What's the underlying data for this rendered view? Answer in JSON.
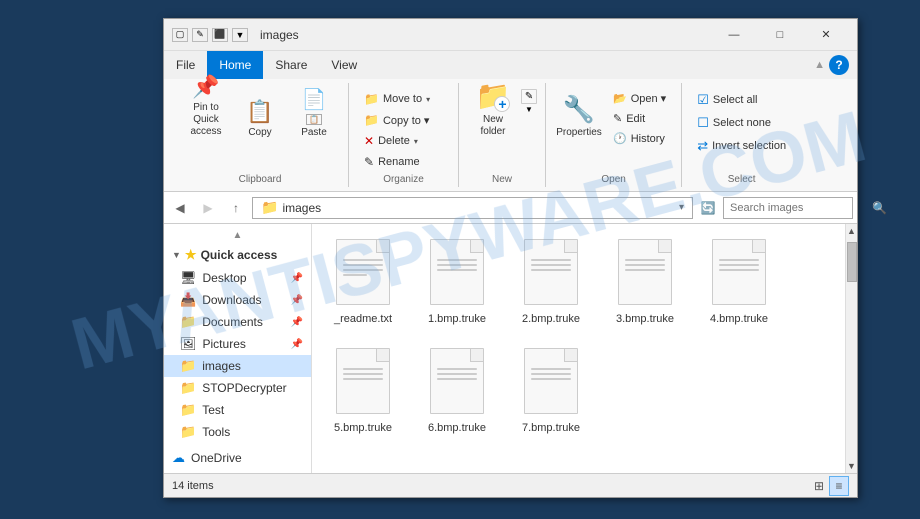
{
  "window": {
    "title": "images",
    "title_prefix": "▢ ✎ ⬛ ▼ ▪",
    "minimize": "—",
    "maximize": "□",
    "close": "✕"
  },
  "menu": {
    "items": [
      "File",
      "Home",
      "Share",
      "View"
    ],
    "active": "Home"
  },
  "ribbon": {
    "groups": [
      {
        "label": "Clipboard",
        "buttons": [
          {
            "id": "pin-to-quick",
            "icon": "📌",
            "label": "Pin to Quick\naccess",
            "large": true
          },
          {
            "id": "copy",
            "icon": "📋",
            "label": "Copy",
            "large": true
          },
          {
            "id": "paste",
            "icon": "📄",
            "label": "Paste",
            "large": true
          }
        ]
      },
      {
        "label": "Organize",
        "small_rows": [
          {
            "id": "move-to",
            "icon": "📁",
            "label": "Move to ▾"
          },
          {
            "id": "copy-to",
            "icon": "📁",
            "label": "Copy to ▾"
          },
          {
            "id": "delete",
            "icon": "✕",
            "label": "Delete ▾"
          },
          {
            "id": "rename",
            "icon": "✎",
            "label": "Rename"
          }
        ]
      },
      {
        "label": "New",
        "buttons": [
          {
            "id": "new-folder",
            "icon": "📁",
            "label": "New\nfolder",
            "large": true
          },
          {
            "id": "new-item",
            "icon": "▼",
            "label": "▼",
            "large": false
          }
        ]
      },
      {
        "label": "Open",
        "buttons": [
          {
            "id": "properties",
            "icon": "⚙",
            "label": "Properties",
            "large": true
          }
        ],
        "small_rows": [
          {
            "id": "open",
            "icon": "📂",
            "label": "Open ▾"
          },
          {
            "id": "edit",
            "icon": "✎",
            "label": "Edit"
          },
          {
            "id": "history",
            "icon": "🕐",
            "label": "History"
          }
        ]
      },
      {
        "label": "Select",
        "small_rows": [
          {
            "id": "select-all",
            "icon": "☑",
            "label": "Select all"
          },
          {
            "id": "select-none",
            "icon": "☐",
            "label": "Select none"
          },
          {
            "id": "invert-selection",
            "icon": "⇄",
            "label": "Invert selection"
          }
        ]
      }
    ]
  },
  "address_bar": {
    "back_disabled": false,
    "forward_disabled": true,
    "up": "↑",
    "path": "images",
    "search_placeholder": "Search images"
  },
  "sidebar": {
    "sections": [
      {
        "id": "quick-access",
        "label": "Quick access",
        "icon": "⭐",
        "expanded": true,
        "items": [
          {
            "id": "desktop",
            "label": "Desktop",
            "icon": "🖥",
            "pinned": true
          },
          {
            "id": "downloads",
            "label": "Downloads",
            "icon": "📥",
            "pinned": true
          },
          {
            "id": "documents",
            "label": "Documents",
            "icon": "📁",
            "pinned": true
          },
          {
            "id": "pictures",
            "label": "Pictures",
            "icon": "🖼",
            "pinned": true
          },
          {
            "id": "images",
            "label": "images",
            "icon": "📁",
            "selected": true
          },
          {
            "id": "stopdecrypter",
            "label": "STOPDecrypter",
            "icon": "📁"
          },
          {
            "id": "test",
            "label": "Test",
            "icon": "📁"
          },
          {
            "id": "tools",
            "label": "Tools",
            "icon": "📁"
          }
        ]
      },
      {
        "id": "onedrive",
        "label": "OneDrive",
        "icon": "☁"
      }
    ]
  },
  "files": {
    "items": [
      {
        "id": "readme",
        "name": "_readme.txt",
        "type": "txt"
      },
      {
        "id": "file1",
        "name": "1.bmp.truke",
        "type": "truke"
      },
      {
        "id": "file2",
        "name": "2.bmp.truke",
        "type": "truke"
      },
      {
        "id": "file3",
        "name": "3.bmp.truke",
        "type": "truke"
      },
      {
        "id": "file4",
        "name": "4.bmp.truke",
        "type": "truke"
      },
      {
        "id": "file5",
        "name": "5.bmp.truke",
        "type": "truke"
      },
      {
        "id": "file6",
        "name": "6.bmp.truke",
        "type": "truke"
      },
      {
        "id": "file7",
        "name": "7.bmp.truke",
        "type": "truke"
      }
    ]
  },
  "status_bar": {
    "item_count": "14 items"
  },
  "icons": {
    "back": "◀",
    "forward": "▶",
    "up": "↑",
    "refresh": "🔄",
    "search": "🔍",
    "chevron_down": "▾",
    "scroll_up": "▲",
    "scroll_down": "▼",
    "view_tiles": "⊞",
    "view_list": "≡"
  }
}
